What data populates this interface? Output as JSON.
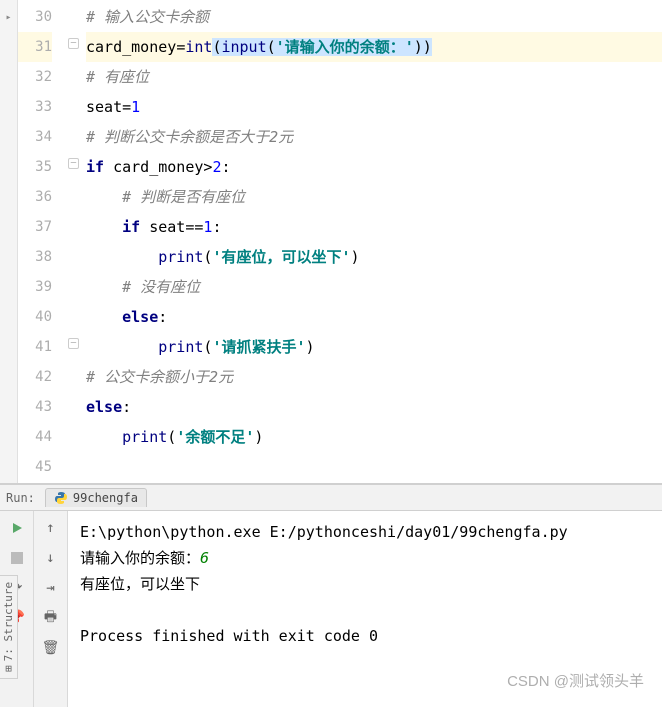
{
  "editor": {
    "lines": [
      {
        "num": 30,
        "indent": 0,
        "type": "comment",
        "text": "# 输入公交卡余额"
      },
      {
        "num": 31,
        "indent": 0,
        "type": "code",
        "current": true
      },
      {
        "num": 32,
        "indent": 0,
        "type": "comment",
        "text": "# 有座位"
      },
      {
        "num": 33,
        "indent": 0,
        "type": "assign",
        "lhs": "seat",
        "rhs": "1"
      },
      {
        "num": 34,
        "indent": 0,
        "type": "comment",
        "text": "# 判断公交卡余额是否大于2元"
      },
      {
        "num": 35,
        "indent": 0,
        "type": "if_card"
      },
      {
        "num": 36,
        "indent": 1,
        "type": "comment",
        "text": "# 判断是否有座位"
      },
      {
        "num": 37,
        "indent": 1,
        "type": "if_seat"
      },
      {
        "num": 38,
        "indent": 2,
        "type": "print",
        "str": "'有座位，可以坐下'"
      },
      {
        "num": 39,
        "indent": 1,
        "type": "comment",
        "text": "# 没有座位"
      },
      {
        "num": 40,
        "indent": 1,
        "type": "else"
      },
      {
        "num": 41,
        "indent": 2,
        "type": "print",
        "str": "'请抓紧扶手'"
      },
      {
        "num": 42,
        "indent": 0,
        "type": "comment",
        "text": "# 公交卡余额小于2元"
      },
      {
        "num": 43,
        "indent": 0,
        "type": "else"
      },
      {
        "num": 44,
        "indent": 1,
        "type": "print",
        "str": "'余额不足'"
      },
      {
        "num": 45,
        "indent": 0,
        "type": "empty"
      }
    ],
    "line31": {
      "lhs": "card_money",
      "builtin1": "int",
      "builtin2": "input",
      "str": "'请输入你的余额：'"
    },
    "if_card": {
      "kw": "if",
      "var": "card_money",
      "op": ">",
      "val": "2"
    },
    "if_seat": {
      "kw": "if",
      "var": "seat",
      "op": "==",
      "val": "1"
    },
    "else_kw": "else",
    "print_fn": "print",
    "seat_assign": {
      "lhs": "seat",
      "val": "1"
    }
  },
  "run": {
    "label": "Run:",
    "tab_name": "99chengfa",
    "console": {
      "line1": "E:\\python\\python.exe E:/pythonceshi/day01/99chengfa.py",
      "line2_prefix": "请输入你的余额：",
      "line2_input": "6",
      "line3": "有座位，可以坐下",
      "line4": "",
      "line5": "Process finished with exit code 0"
    }
  },
  "sidebar": {
    "structure_label": "7: Structure"
  },
  "watermark": "CSDN @测试领头羊"
}
